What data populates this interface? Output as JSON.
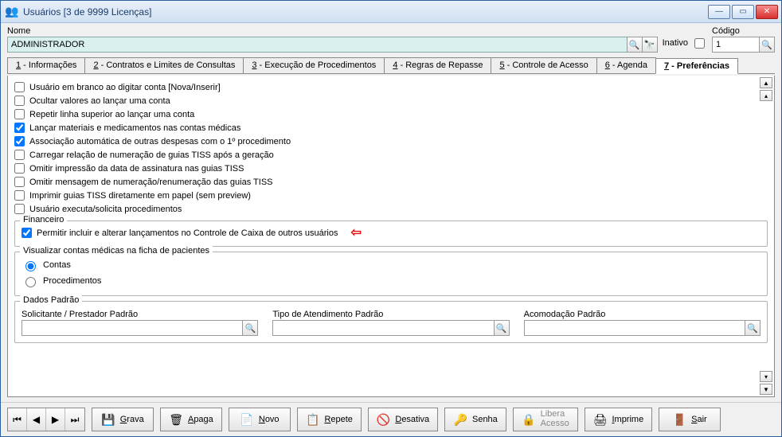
{
  "window": {
    "title": "Usuários [3 de 9999 Licenças]"
  },
  "header": {
    "nome_label": "Nome",
    "nome_value": "ADMINISTRADOR",
    "inativo_label": "Inativo",
    "codigo_label": "Código",
    "codigo_value": "1"
  },
  "tabs": [
    {
      "num": "1",
      "label": "Informações"
    },
    {
      "num": "2",
      "label": "Contratos e Limites de Consultas"
    },
    {
      "num": "3",
      "label": "Execução de Procedimentos"
    },
    {
      "num": "4",
      "label": "Regras de Repasse"
    },
    {
      "num": "5",
      "label": "Controle de Acesso"
    },
    {
      "num": "6",
      "label": "Agenda"
    },
    {
      "num": "7",
      "label": "Preferências"
    }
  ],
  "prefs": {
    "checks": [
      {
        "label": "Usuário em branco ao digitar conta [Nova/Inserir]",
        "checked": false
      },
      {
        "label": "Ocultar valores ao lançar uma conta",
        "checked": false
      },
      {
        "label": "Repetir linha superior ao lançar uma conta",
        "checked": false
      },
      {
        "label": "Lançar materiais e medicamentos nas contas médicas",
        "checked": true
      },
      {
        "label": "Associação automática de outras despesas com o 1º procedimento",
        "checked": true
      },
      {
        "label": "Carregar relação de numeração de guias TISS após a geração",
        "checked": false
      },
      {
        "label": "Omitir impressão da data de assinatura nas guias TISS",
        "checked": false
      },
      {
        "label": "Omitir mensagem de numeração/renumeração das guias TISS",
        "checked": false
      },
      {
        "label": "Imprimir guias TISS diretamente em papel (sem preview)",
        "checked": false
      },
      {
        "label": "Usuário executa/solicita procedimentos",
        "checked": false
      }
    ],
    "financeiro": {
      "legend": "Financeiro",
      "check": {
        "label": "Permitir incluir e alterar lançamentos no Controle de Caixa de outros usuários",
        "checked": true
      }
    },
    "visualizar": {
      "legend": "Visualizar contas médicas na ficha de pacientes",
      "options": [
        {
          "label": "Contas",
          "selected": true
        },
        {
          "label": "Procedimentos",
          "selected": false
        }
      ]
    },
    "dados_padrao": {
      "legend": "Dados Padrão",
      "solicitante_label": "Solicitante / Prestador Padrão",
      "tipo_label": "Tipo de Atendimento Padrão",
      "acomodacao_label": "Acomodação Padrão",
      "solicitante_value": "",
      "tipo_value": "",
      "acomodacao_value": ""
    }
  },
  "toolbar": {
    "grava": "Grava",
    "apaga": "Apaga",
    "novo": "Novo",
    "repete": "Repete",
    "desativa": "Desativa",
    "senha": "Senha",
    "libera1": "Libera",
    "libera2": "Acesso",
    "imprime": "Imprime",
    "sair": "Sair"
  }
}
